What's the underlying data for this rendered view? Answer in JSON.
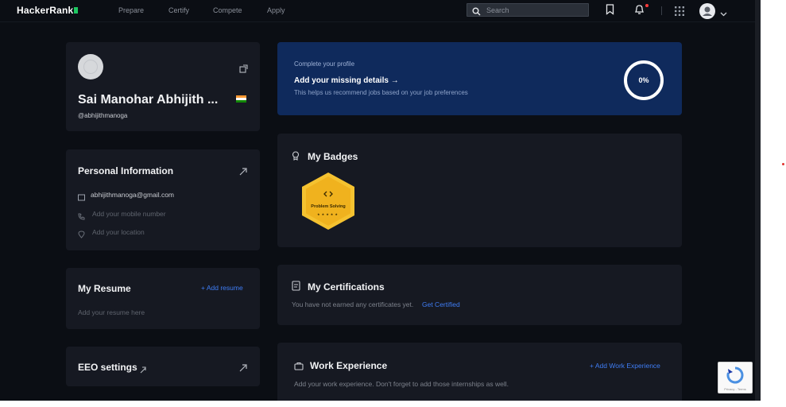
{
  "topbar": {
    "logo": "HackerRank",
    "nav": [
      "Prepare",
      "Certify",
      "Compete",
      "Apply"
    ],
    "search_placeholder": "Search"
  },
  "profile": {
    "name": "Sai Manohar Abhijith ...",
    "username": "@abhijithmanoga"
  },
  "personal_info": {
    "title": "Personal Information",
    "email": "abhijithmanoga@gmail.com",
    "mobile": "Add your mobile number",
    "location": "Add your location"
  },
  "resume": {
    "title": "My Resume",
    "add_label": "+ Add resume",
    "text": "Add your resume here"
  },
  "eeo": {
    "title": "EEO settings"
  },
  "banner": {
    "small": "Complete your profile",
    "title": "Add your missing details →",
    "sub": "This helps us recommend jobs based on your job preferences",
    "progress": "0%"
  },
  "badges": {
    "title": "My Badges",
    "items": [
      {
        "name": "Problem Solving",
        "stars": 0
      }
    ]
  },
  "certifications": {
    "title": "My Certifications",
    "text": "You have not earned any certificates yet.",
    "link": "Get Certified"
  },
  "work": {
    "title": "Work Experience",
    "add_label": "+ Add Work Experience",
    "text": "Add your work experience. Don't forget to add those internships as well."
  },
  "recaptcha": {
    "label": "Privacy - Terms"
  },
  "colors": {
    "background": "#0b0e14",
    "card": "#161922",
    "banner": "#0f2a5c",
    "accent_link": "#3f7df5",
    "logo_mark": "#1ec761",
    "badge": "#f5c230"
  }
}
